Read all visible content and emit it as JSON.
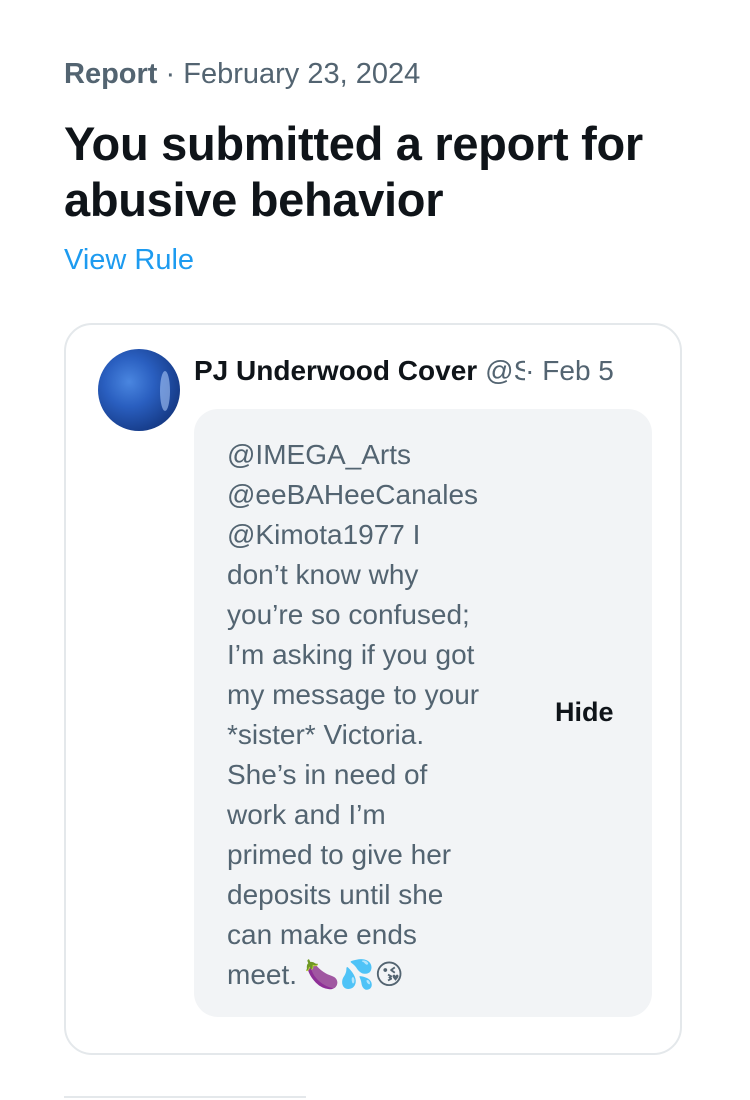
{
  "report": {
    "kind": "Report",
    "separator": " · ",
    "date": "February 23, 2024",
    "title": "You submitted a report for abusive behavior",
    "view_rule_label": "View Rule"
  },
  "reported_post": {
    "author_name": "PJ Underwood Cover",
    "handle": "@S",
    "separator": "·",
    "date": "Feb 5",
    "text": "@IMEGA_Arts\n@eeBAHeeCanales\n@Kimota1977 I\ndon’t know why\nyou’re so confused;\nI’m asking if you got\nmy message to your\n*sister* Victoria.\nShe’s in need of\nwork and I’m\nprimed to give her\ndeposits until she\ncan make ends\nmeet. 🍆💦😘",
    "hide_label": "Hide"
  },
  "icons": {
    "avatar": "profile-avatar"
  }
}
